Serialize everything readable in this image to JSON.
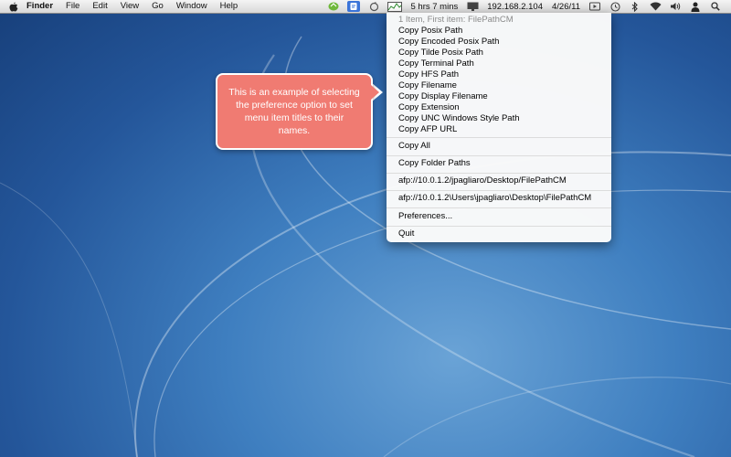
{
  "menubar": {
    "left_items": [
      "Finder",
      "File",
      "Edit",
      "View",
      "Go",
      "Window",
      "Help"
    ],
    "battery_text": "5 hrs 7 mins",
    "ip_text": "192.168.2.104",
    "date_text": "4/26/11",
    "icons": [
      "apple-icon",
      "sync-icon",
      "filepath-icon",
      "refresh-icon",
      "activity-monitor-icon",
      "battery-icon",
      "display-icon",
      "media-icon",
      "time-machine-icon",
      "bluetooth-icon",
      "wifi-icon",
      "volume-icon",
      "user-icon",
      "spotlight-icon"
    ]
  },
  "menu": {
    "header": "1 Item, First item: FilePathCM",
    "group1": [
      "Copy Posix Path",
      "Copy Encoded Posix Path",
      "Copy Tilde Posix Path",
      "Copy Terminal Path",
      "Copy HFS Path",
      "Copy Filename",
      "Copy Display Filename",
      "Copy Extension",
      "Copy UNC Windows Style Path",
      "Copy AFP URL"
    ],
    "copy_all": "Copy All",
    "copy_folder_paths": "Copy Folder Paths",
    "afp_url_1": "afp://10.0.1.2/jpagliaro/Desktop/FilePathCM",
    "afp_url_2": "afp://10.0.1.2\\Users\\jpagliaro\\Desktop\\FilePathCM",
    "preferences": "Preferences...",
    "quit": "Quit"
  },
  "callout": {
    "text": "This is an example of selecting the preference option to set menu item titles to their names."
  },
  "colors": {
    "callout_fill": "#f07b72",
    "menubar_highlight": "#3b74d9",
    "desktop_blue": "#2a5fa3"
  }
}
